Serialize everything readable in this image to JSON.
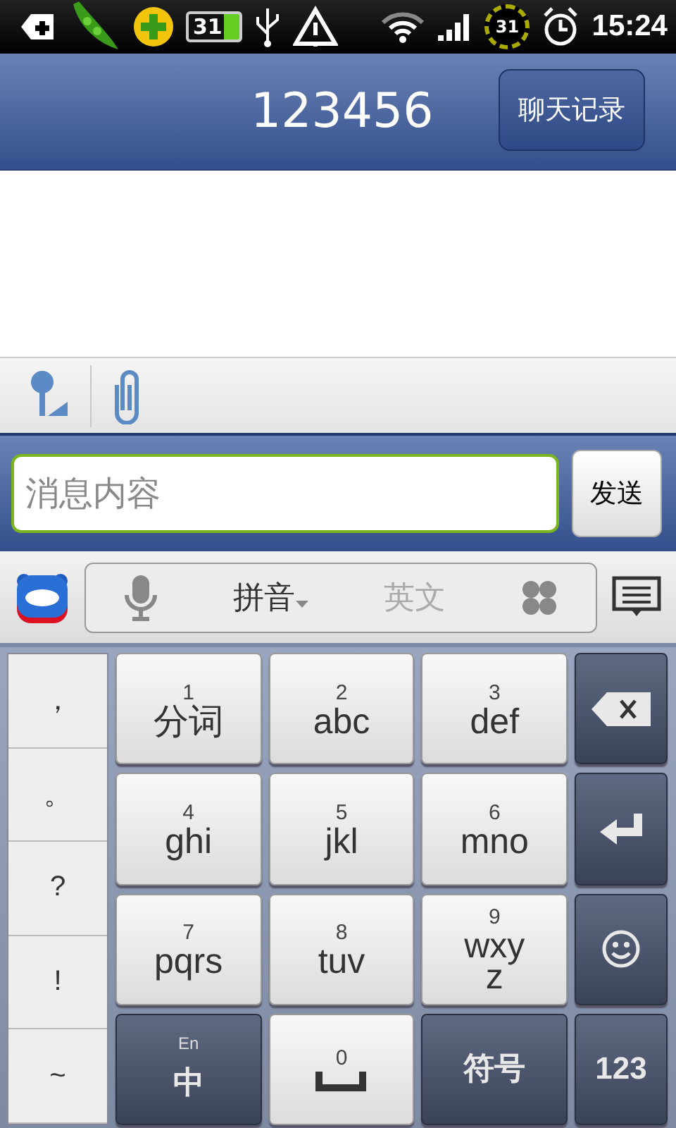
{
  "status_bar": {
    "battery_text": "31",
    "calendar_badge": "31",
    "time": "15:24"
  },
  "header": {
    "title": "123456",
    "history_button": "聊天记录"
  },
  "composer": {
    "placeholder": "消息内容",
    "send_button": "发送"
  },
  "ime_bar": {
    "modes": [
      {
        "label": "拼音",
        "selected": true
      },
      {
        "label": "英文",
        "selected": false
      }
    ]
  },
  "keyboard": {
    "symbols": [
      "，",
      "。",
      "?",
      "!",
      "~"
    ],
    "keys": [
      {
        "kind": "letter",
        "digit": "1",
        "letters": "分词"
      },
      {
        "kind": "letter",
        "digit": "2",
        "letters": "abc"
      },
      {
        "kind": "letter",
        "digit": "3",
        "letters": "def"
      },
      {
        "kind": "backspace"
      },
      {
        "kind": "letter",
        "digit": "4",
        "letters": "ghi"
      },
      {
        "kind": "letter",
        "digit": "5",
        "letters": "jkl"
      },
      {
        "kind": "letter",
        "digit": "6",
        "letters": "mno"
      },
      {
        "kind": "enter"
      },
      {
        "kind": "letter",
        "digit": "7",
        "letters": "pqrs"
      },
      {
        "kind": "letter",
        "digit": "8",
        "letters": "tuv"
      },
      {
        "kind": "letter",
        "digit": "9",
        "letters": "wxyz"
      },
      {
        "kind": "emoji"
      },
      {
        "kind": "lang",
        "small": "En",
        "label": "中"
      },
      {
        "kind": "space",
        "digit": "0"
      },
      {
        "kind": "dark",
        "label": "符号"
      },
      {
        "kind": "dark",
        "label": "123"
      }
    ]
  }
}
